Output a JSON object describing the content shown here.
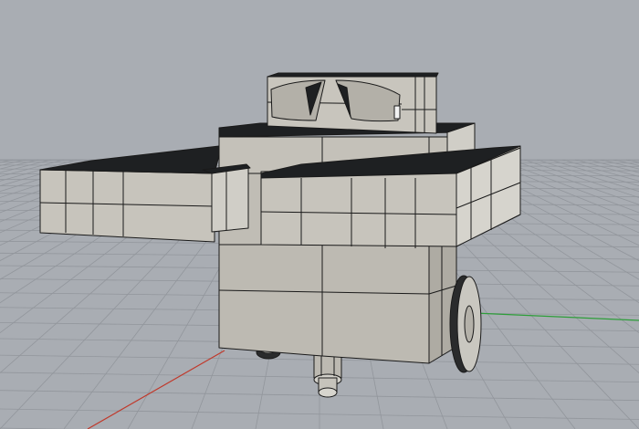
{
  "viewport": {
    "background": "#a9adb3",
    "grid_color": "#8f949a",
    "axis_x_color": "#c0392b",
    "axis_y_color": "#2e9e3a",
    "model_face_light": "#cfcdc6",
    "model_face_mid": "#b8b5ad",
    "model_face_dark": "#1e2022",
    "edge_color": "#1a1a1a"
  }
}
